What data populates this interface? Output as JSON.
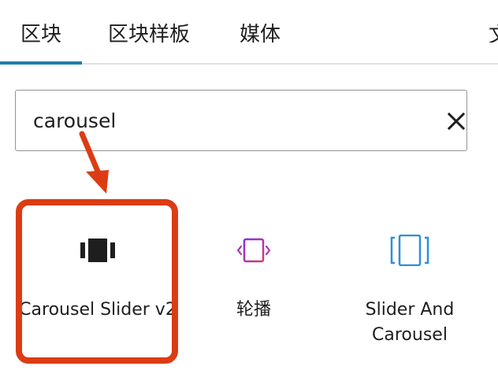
{
  "tabs": [
    {
      "label": "区块",
      "active": true
    },
    {
      "label": "区块样板",
      "active": false
    },
    {
      "label": "媒体",
      "active": false
    }
  ],
  "tabs_overflow_glyph": "文",
  "search": {
    "value": "carousel",
    "placeholder": ""
  },
  "results": [
    {
      "label": "Carousel Slider v2",
      "icon": "carousel-slider-icon"
    },
    {
      "label": "轮播",
      "icon": "carousel-slides-icon"
    },
    {
      "label": "Slider And Carousel",
      "icon": "slider-frame-icon"
    }
  ],
  "colors": {
    "accent": "#1e7ea8",
    "annotation": "#dc3c14",
    "text": "#1e1e1e",
    "icon_purple": "#8a2be2",
    "icon_pink": "#d63a7a",
    "icon_blue": "#2f8fd8"
  }
}
